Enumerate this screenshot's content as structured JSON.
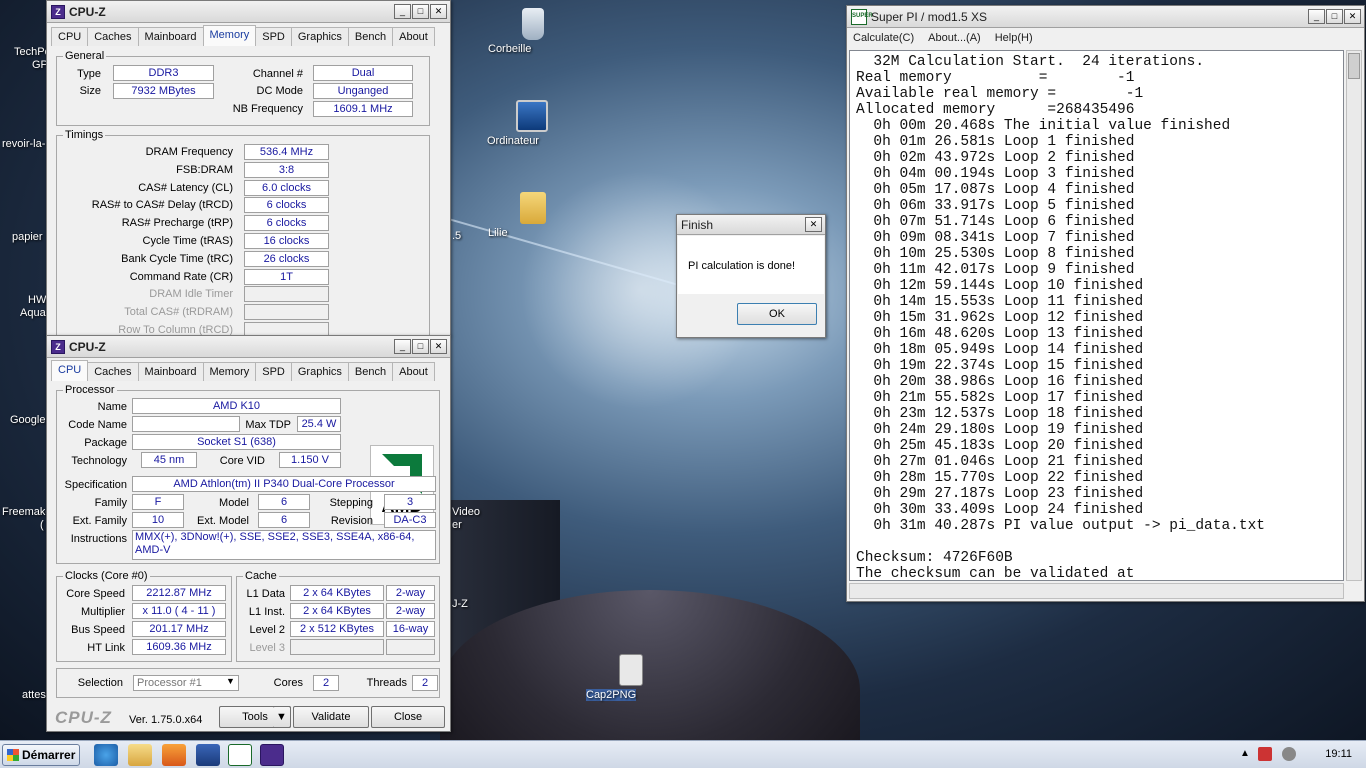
{
  "desktop": {
    "icons": [
      {
        "label": "Corbeille"
      },
      {
        "label": "Ordinateur"
      },
      {
        "label": "Lilie"
      },
      {
        "label": "Cap2PNG"
      }
    ],
    "left_labels": [
      "TechPo",
      "GP",
      "revoir-la-",
      "papier",
      "HW",
      "Aqua",
      "Google",
      "Freemake",
      "(",
      "attes"
    ],
    "partial_labels": [
      ".5",
      "Video",
      "er",
      "J-Z"
    ]
  },
  "cpuz_memory": {
    "title": "CPU-Z",
    "tabs": [
      "CPU",
      "Caches",
      "Mainboard",
      "Memory",
      "SPD",
      "Graphics",
      "Bench",
      "About"
    ],
    "active_tab": "Memory",
    "general": {
      "title": "General",
      "type_label": "Type",
      "type": "DDR3",
      "size_label": "Size",
      "size": "7932 MBytes",
      "channel_label": "Channel #",
      "channel": "Dual",
      "dcmode_label": "DC Mode",
      "dcmode": "Unganged",
      "nbfreq_label": "NB Frequency",
      "nbfreq": "1609.1 MHz"
    },
    "timings": {
      "title": "Timings",
      "rows": [
        {
          "label": "DRAM Frequency",
          "value": "536.4 MHz"
        },
        {
          "label": "FSB:DRAM",
          "value": "3:8"
        },
        {
          "label": "CAS# Latency (CL)",
          "value": "6.0 clocks"
        },
        {
          "label": "RAS# to CAS# Delay (tRCD)",
          "value": "6 clocks"
        },
        {
          "label": "RAS# Precharge (tRP)",
          "value": "6 clocks"
        },
        {
          "label": "Cycle Time (tRAS)",
          "value": "16 clocks"
        },
        {
          "label": "Bank Cycle Time (tRC)",
          "value": "26 clocks"
        },
        {
          "label": "Command Rate (CR)",
          "value": "1T"
        },
        {
          "label": "DRAM Idle Timer",
          "value": ""
        },
        {
          "label": "Total CAS# (tRDRAM)",
          "value": ""
        },
        {
          "label": "Row To Column (tRCD)",
          "value": ""
        }
      ]
    }
  },
  "cpuz_cpu": {
    "title": "CPU-Z",
    "tabs": [
      "CPU",
      "Caches",
      "Mainboard",
      "Memory",
      "SPD",
      "Graphics",
      "Bench",
      "About"
    ],
    "active_tab": "CPU",
    "processor": {
      "title": "Processor",
      "name_label": "Name",
      "name": "AMD K10",
      "codename_label": "Code Name",
      "codename": "",
      "maxtdp_label": "Max TDP",
      "maxtdp": "25.4 W",
      "package_label": "Package",
      "package": "Socket S1 (638)",
      "tech_label": "Technology",
      "tech": "45 nm",
      "corevid_label": "Core VID",
      "corevid": "1.150 V",
      "spec_label": "Specification",
      "spec": "AMD Athlon(tm) II P340 Dual-Core Processor",
      "family_label": "Family",
      "family": "F",
      "model_label": "Model",
      "model": "6",
      "stepping_label": "Stepping",
      "stepping": "3",
      "extfamily_label": "Ext. Family",
      "extfamily": "10",
      "extmodel_label": "Ext. Model",
      "extmodel": "6",
      "revision_label": "Revision",
      "revision": "DA-C3",
      "instr_label": "Instructions",
      "instr": "MMX(+), 3DNow!(+), SSE, SSE2, SSE3, SSE4A, x86-64, AMD-V",
      "logo": "AMD"
    },
    "clocks": {
      "title": "Clocks (Core #0)",
      "corespeed_label": "Core Speed",
      "corespeed": "2212.87 MHz",
      "mult_label": "Multiplier",
      "mult": "x 11.0 ( 4 - 11 )",
      "bus_label": "Bus Speed",
      "bus": "201.17 MHz",
      "ht_label": "HT Link",
      "ht": "1609.36 MHz"
    },
    "cache": {
      "title": "Cache",
      "l1d_label": "L1 Data",
      "l1d": "2 x 64 KBytes",
      "l1d_way": "2-way",
      "l1i_label": "L1 Inst.",
      "l1i": "2 x 64 KBytes",
      "l1i_way": "2-way",
      "l2_label": "Level 2",
      "l2": "2 x 512 KBytes",
      "l2_way": "16-way",
      "l3_label": "Level 3"
    },
    "selection_label": "Selection",
    "selection": "Processor #1",
    "cores_label": "Cores",
    "cores": "2",
    "threads_label": "Threads",
    "threads": "2",
    "brand": "CPU-Z",
    "version": "Ver. 1.75.0.x64",
    "tools": "Tools",
    "validate": "Validate",
    "close": "Close"
  },
  "finish": {
    "title": "Finish",
    "message": "PI calculation is done!",
    "ok": "OK"
  },
  "superpi": {
    "title": "Super PI / mod1.5 XS",
    "icon_text": "SUPER",
    "menu": [
      "Calculate(C)",
      "About...(A)",
      "Help(H)"
    ],
    "lines": [
      "  32M Calculation Start.  24 iterations.",
      "Real memory          =        -1",
      "Available real memory =        -1",
      "Allocated memory      =268435496",
      "  0h 00m 20.468s The initial value finished",
      "  0h 01m 26.581s Loop 1 finished",
      "  0h 02m 43.972s Loop 2 finished",
      "  0h 04m 00.194s Loop 3 finished",
      "  0h 05m 17.087s Loop 4 finished",
      "  0h 06m 33.917s Loop 5 finished",
      "  0h 07m 51.714s Loop 6 finished",
      "  0h 09m 08.341s Loop 7 finished",
      "  0h 10m 25.530s Loop 8 finished",
      "  0h 11m 42.017s Loop 9 finished",
      "  0h 12m 59.144s Loop 10 finished",
      "  0h 14m 15.553s Loop 11 finished",
      "  0h 15m 31.962s Loop 12 finished",
      "  0h 16m 48.620s Loop 13 finished",
      "  0h 18m 05.949s Loop 14 finished",
      "  0h 19m 22.374s Loop 15 finished",
      "  0h 20m 38.986s Loop 16 finished",
      "  0h 21m 55.582s Loop 17 finished",
      "  0h 23m 12.537s Loop 18 finished",
      "  0h 24m 29.180s Loop 19 finished",
      "  0h 25m 45.183s Loop 20 finished",
      "  0h 27m 01.046s Loop 21 finished",
      "  0h 28m 15.770s Loop 22 finished",
      "  0h 29m 27.187s Loop 23 finished",
      "  0h 30m 33.409s Loop 24 finished",
      "  0h 31m 40.287s PI value output -> pi_data.txt",
      "",
      "Checksum: 4726F60B",
      "The checksum can be validated at"
    ]
  },
  "taskbar": {
    "start": "Démarrer",
    "clock": "19:11"
  }
}
